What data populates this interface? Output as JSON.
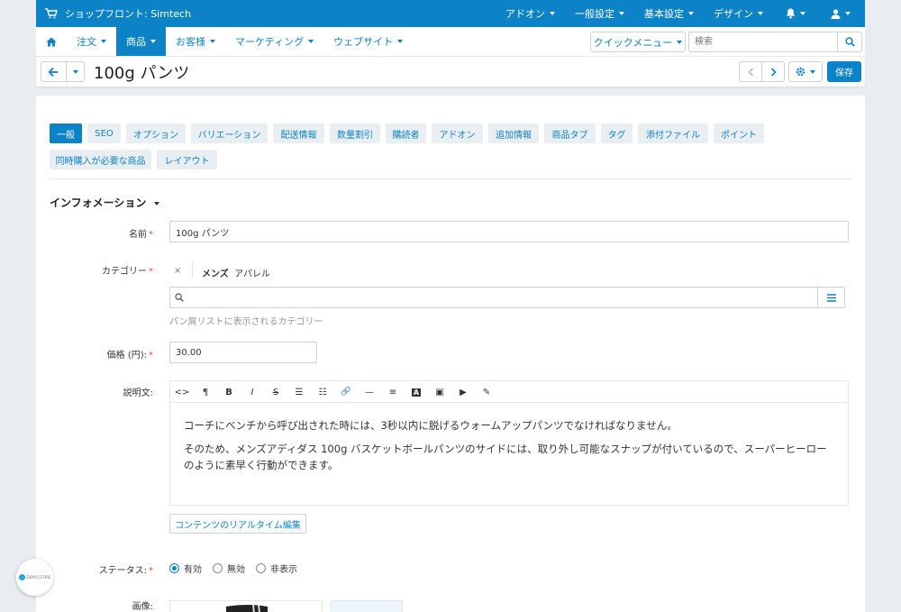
{
  "topbar": {
    "store_label": "ショップフロント: Simtech",
    "menus": [
      "アドオン",
      "一般設定",
      "基本設定",
      "デザイン"
    ]
  },
  "nav": {
    "items": [
      {
        "label": "注文",
        "active": false
      },
      {
        "label": "商品",
        "active": true
      },
      {
        "label": "お客様",
        "active": false
      },
      {
        "label": "マーケティング",
        "active": false
      },
      {
        "label": "ウェブサイト",
        "active": false
      }
    ],
    "quick_menu": "クイックメニュー",
    "search_placeholder": "検索"
  },
  "header": {
    "title": "100g パンツ",
    "save": "保存"
  },
  "tabs": [
    "一般",
    "SEO",
    "オプション",
    "バリエーション",
    "配送情報",
    "数量割引",
    "購読者",
    "アドオン",
    "追加情報",
    "商品タブ",
    "タグ",
    "添付ファイル",
    "ポイント",
    "同時購入が必要な商品",
    "レイアウト"
  ],
  "form": {
    "section_title": "インフォメーション",
    "name_label": "名前",
    "name_value": "100g パンツ",
    "category_label": "カテゴリー",
    "category_remove": "×",
    "category_main": "メンズ",
    "category_sub": "アパレル",
    "category_hint": "パン屑リストに表示されるカテゴリー",
    "price_label": "価格 (円):",
    "price_value": "30.00",
    "desc_label": "説明文:",
    "desc_p1": "コーチにベンチから呼び出された時には、3秒以内に脱げるウォームアップパンツでなければなりません。",
    "desc_p2": "そのため、メンズアディダス 100g バスケットボールパンツのサイドには、取り外し可能なスナップが付いているので、スーパーヒーローのように素早く行動ができます。",
    "live_edit": "コンテンツのリアルタイム編集",
    "status_label": "ステータス:",
    "status_options": [
      "有効",
      "無効",
      "非表示"
    ],
    "status_selected": "有効",
    "image_label": "画像:"
  },
  "toolbar_glyphs": [
    "<>",
    "¶",
    "B",
    "I",
    "S",
    "☰",
    "☷",
    "🔗",
    "—",
    "≡",
    "A",
    "▣",
    "▶",
    "✎"
  ],
  "demo_label": "DEMO STORE",
  "colors": {
    "accent": "#0b83c6",
    "required": "#d9534f",
    "page_bg": "#e9edf1"
  }
}
